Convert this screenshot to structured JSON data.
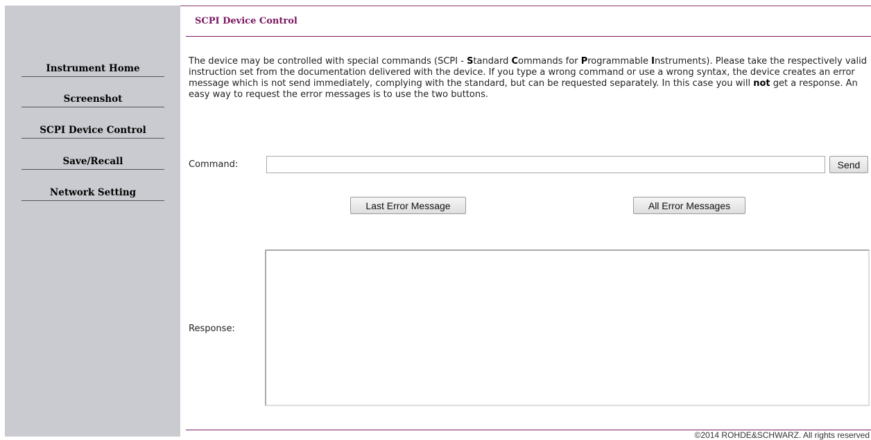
{
  "sidebar": {
    "items": [
      {
        "label": "Instrument Home"
      },
      {
        "label": "Screenshot"
      },
      {
        "label": "SCPI Device Control"
      },
      {
        "label": "Save/Recall"
      },
      {
        "label": "Network Setting"
      }
    ]
  },
  "main": {
    "title": "SCPI Device Control",
    "intro": {
      "p1": "The device may be controlled with special commands (SCPI - ",
      "b1": "S",
      "p2": "tandard ",
      "b2": "C",
      "p3": "ommands for ",
      "b3": "P",
      "p4": "rogrammable ",
      "b4": "I",
      "p5": "nstruments). Please take the respectively valid instruction set from the documentation delivered with the device. If you type a wrong command or use a wrong syntax, the device creates an error message which is not send immediately, complying with the standard, but can be requested separately. In this case you will ",
      "b5": "not",
      "p6": " get a response. An easy way to request the error messages is to use the two buttons."
    },
    "command": {
      "label": "Command:",
      "value": "",
      "send_label": "Send"
    },
    "buttons": {
      "last_error": "Last Error Message",
      "all_errors": "All Error Messages"
    },
    "response": {
      "label": "Response:",
      "value": ""
    }
  },
  "footer": {
    "copyright": "©2014 ROHDE&SCHWARZ. All rights reserved"
  }
}
